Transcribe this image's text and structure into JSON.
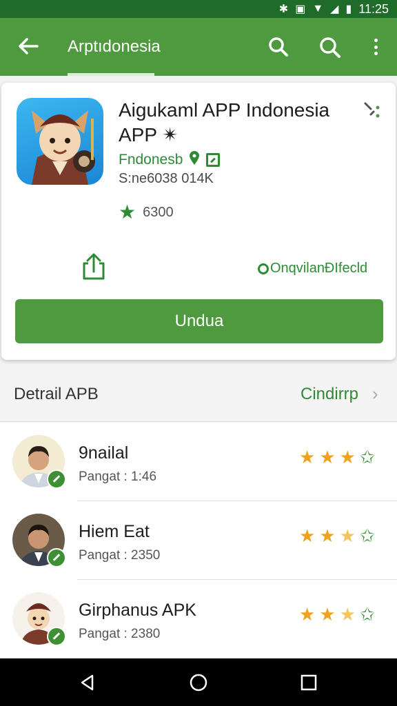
{
  "status_bar": {
    "time": "11:25"
  },
  "app_bar": {
    "title": "Arptıdonesia"
  },
  "app": {
    "name": "Aigukaml APP Indonesia APP ✴",
    "developer": "Fndonesb",
    "size": "S:ne6038  014K",
    "rating": "6300",
    "link_text": "OnqvilanÐIfecld",
    "download_label": "Undua"
  },
  "section": {
    "title": "Detrail APB",
    "more": "Cindirrp"
  },
  "reviews": [
    {
      "name": "9nailal",
      "meta": "Pangat : 1:46",
      "stars": [
        "gold",
        "gold",
        "gold",
        "green"
      ]
    },
    {
      "name": "Hiem Eat",
      "meta": "Pangat : 2350",
      "stars": [
        "gold",
        "gold",
        "half",
        "green"
      ]
    },
    {
      "name": "Girphanus APK",
      "meta": "Pangat : 2380",
      "stars": [
        "gold",
        "gold",
        "half",
        "green"
      ]
    }
  ],
  "colors": {
    "primary": "#4f9a3f",
    "accent": "#2e8b35",
    "star_gold": "#f0a21d",
    "status": "#1f6b2a"
  }
}
